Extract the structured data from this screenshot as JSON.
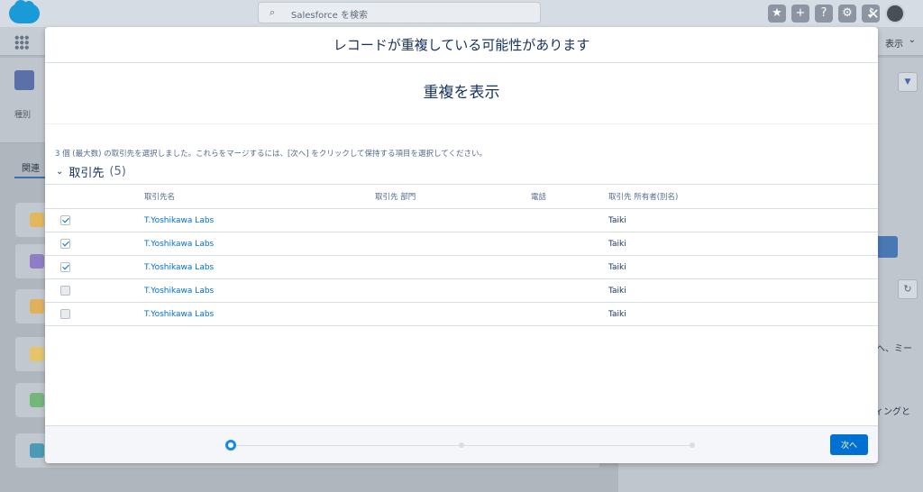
{
  "header": {
    "search_placeholder": "Salesforce を検索"
  },
  "nav": {
    "right_label": "表示"
  },
  "background": {
    "record_type_label": "種別",
    "tab_label": "関連",
    "right_text_1": "へ、ミー",
    "right_text_2": "ィングと",
    "related_icon_colors": [
      "#e3b85c",
      "#8f7ec6",
      "#e0b15b",
      "#e6c46a",
      "#74b77a",
      "#4c9bb5"
    ]
  },
  "modal": {
    "title": "レコードが重複している可能性があります",
    "subtitle": "重複を表示",
    "instructions": "3 個 (最大数) の取引先を選択しました。これらをマージするには、[次へ] をクリックして保持する項目を選択してください。",
    "section": {
      "title": "取引先",
      "count": "(5)"
    },
    "table": {
      "columns": [
        "取引先名",
        "取引先 部門",
        "電話",
        "取引先 所有者(別名)"
      ],
      "rows": [
        {
          "name": "T.Yoshikawa Labs",
          "department": "",
          "phone": "",
          "owner": "Taiki",
          "checked": true
        },
        {
          "name": "T.Yoshikawa Labs",
          "department": "",
          "phone": "",
          "owner": "Taiki",
          "checked": true
        },
        {
          "name": "T.Yoshikawa Labs",
          "department": "",
          "phone": "",
          "owner": "Taiki",
          "checked": true
        },
        {
          "name": "T.Yoshikawa Labs",
          "department": "",
          "phone": "",
          "owner": "Taiki",
          "checked": false
        },
        {
          "name": "T.Yoshikawa Labs",
          "department": "",
          "phone": "",
          "owner": "Taiki",
          "checked": false
        }
      ]
    },
    "footer": {
      "next_label": "次へ",
      "current_step": 1,
      "total_steps": 3
    },
    "close_icon": "close-icon",
    "colors": {
      "accent": "#0070d2",
      "link": "#0070d2",
      "progress_active": "#1589ee"
    }
  }
}
